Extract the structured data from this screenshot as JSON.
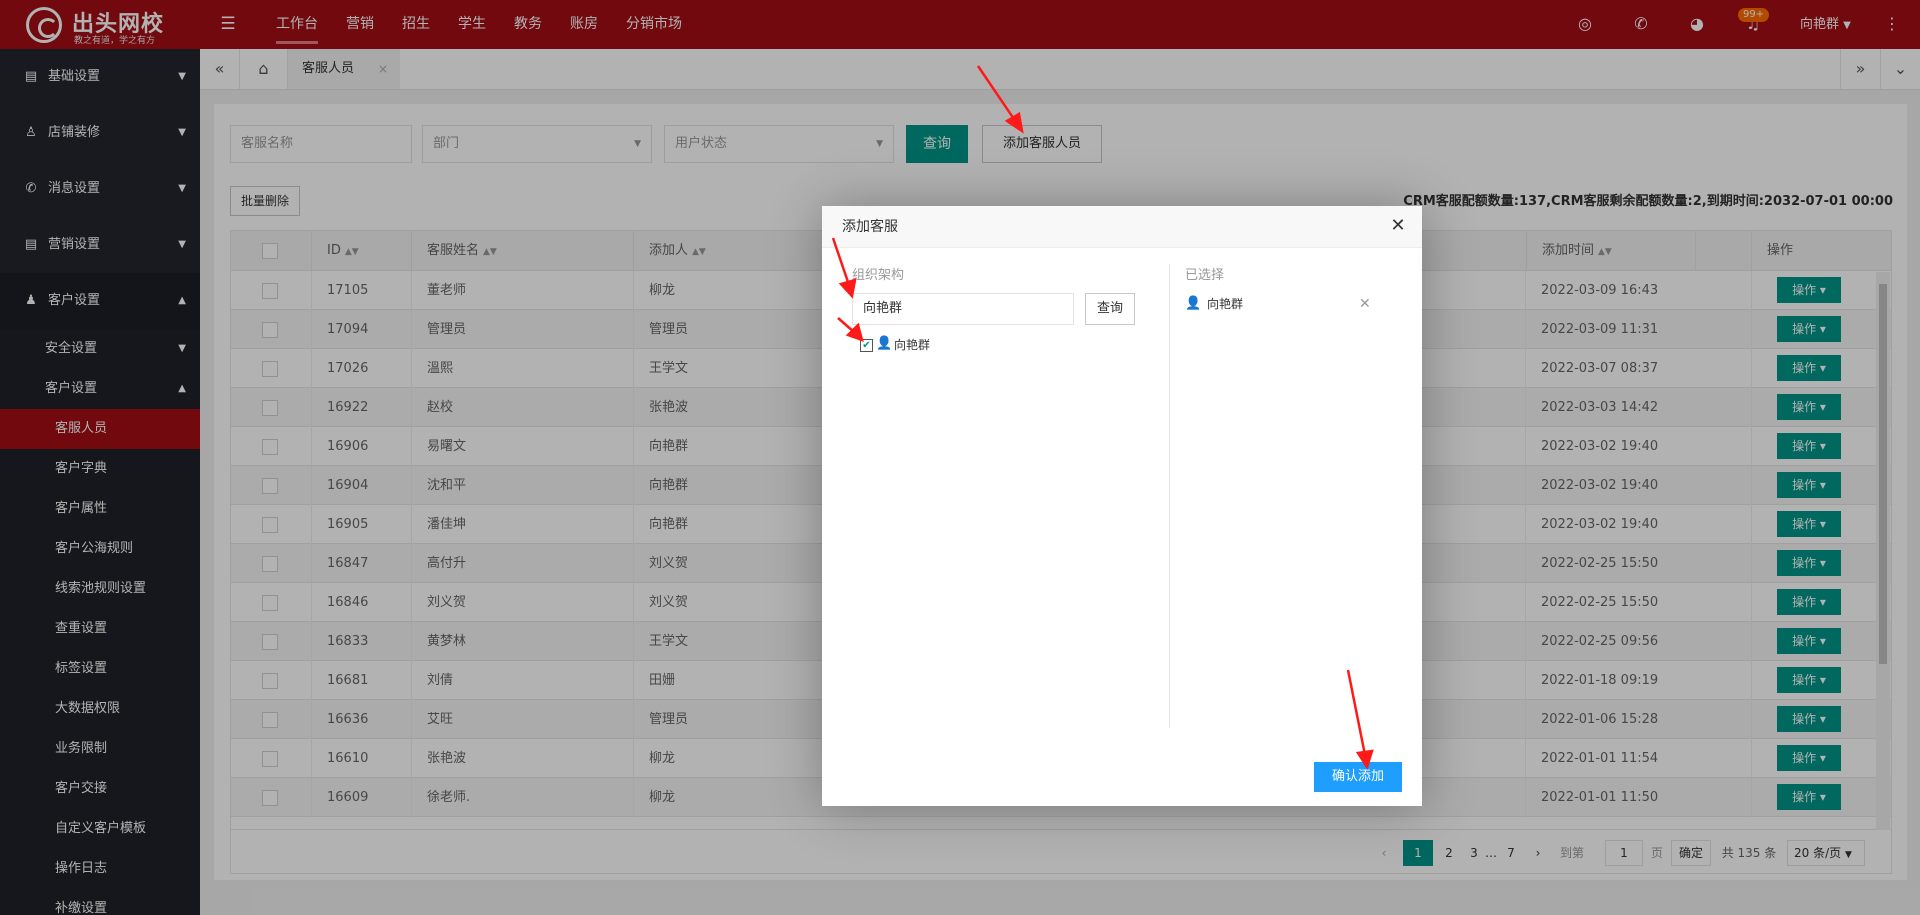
{
  "app": {
    "logo_title": "出头网校",
    "logo_slogan": "教之有道，学之有方"
  },
  "topnav": {
    "items": [
      "工作台",
      "营销",
      "招生",
      "学生",
      "教务",
      "账房",
      "分销市场"
    ],
    "active_index": 0,
    "notif_badge": "99+",
    "user_name": "向艳群"
  },
  "sidebar": {
    "groups": [
      {
        "label": "基础设置",
        "icon": "settings-doc-icon"
      },
      {
        "label": "店铺装修",
        "icon": "user-pen-icon"
      },
      {
        "label": "消息设置",
        "icon": "phone-icon"
      },
      {
        "label": "营销设置",
        "icon": "list-icon"
      },
      {
        "label": "客户设置",
        "icon": "customer-icon"
      }
    ],
    "subgroups": [
      "安全设置",
      "客户设置"
    ],
    "leaves": [
      "客服人员",
      "客户字典",
      "客户属性",
      "客户公海规则",
      "线索池规则设置",
      "查重设置",
      "标签设置",
      "大数据权限",
      "业务限制",
      "客户交接",
      "自定义客户模板",
      "操作日志",
      "补缴设置"
    ]
  },
  "tabbar": {
    "current_tab": "客服人员",
    "close": "×"
  },
  "filters": {
    "name_placeholder": "客服名称",
    "dept_placeholder": "部门",
    "status_placeholder": "用户状态",
    "query_label": "查询",
    "add_label": "添加客服人员",
    "batch_delete_label": "批量删除"
  },
  "crm_info": "CRM客服配额数量:137,CRM客服剩余配额数量:2,到期时间:2032-07-01 00:00",
  "table": {
    "headers": {
      "id": "ID",
      "name": "客服姓名",
      "adder": "添加人",
      "time": "添加时间",
      "op": "操作"
    },
    "op_label": "操作 ▾",
    "rows": [
      {
        "id": "17105",
        "name": "董老师",
        "adder": "柳龙",
        "time": "2022-03-09 16:43"
      },
      {
        "id": "17094",
        "name": "管理员",
        "adder": "管理员",
        "time": "2022-03-09 11:31"
      },
      {
        "id": "17026",
        "name": "溫熙",
        "adder": "王学文",
        "time": "2022-03-07 08:37"
      },
      {
        "id": "16922",
        "name": "赵校",
        "adder": "张艳波",
        "time": "2022-03-03 14:42"
      },
      {
        "id": "16906",
        "name": "易曙文",
        "adder": "向艳群",
        "time": "2022-03-02 19:40"
      },
      {
        "id": "16904",
        "name": "沈和平",
        "adder": "向艳群",
        "time": "2022-03-02 19:40"
      },
      {
        "id": "16905",
        "name": "潘佳坤",
        "adder": "向艳群",
        "time": "2022-03-02 19:40"
      },
      {
        "id": "16847",
        "name": "高付升",
        "adder": "刘义贺",
        "time": "2022-02-25 15:50"
      },
      {
        "id": "16846",
        "name": "刘义贺",
        "adder": "刘义贺",
        "time": "2022-02-25 15:50"
      },
      {
        "id": "16833",
        "name": "黄梦林",
        "adder": "王学文",
        "time": "2022-02-25 09:56"
      },
      {
        "id": "16681",
        "name": "刘倩",
        "adder": "田姗",
        "time": "2022-01-18 09:19"
      },
      {
        "id": "16636",
        "name": "艾旺",
        "adder": "管理员",
        "time": "2022-01-06 15:28"
      },
      {
        "id": "16610",
        "name": "张艳波",
        "adder": "柳龙",
        "time": "2022-01-01 11:54"
      },
      {
        "id": "16609",
        "name": "徐老师.",
        "adder": "柳龙",
        "time": "2022-01-01 11:50"
      }
    ]
  },
  "pager": {
    "prev": "‹",
    "pages": [
      "1",
      "2",
      "3",
      "…",
      "7"
    ],
    "current": "1",
    "next": "›",
    "goto_label": "到第",
    "goto_value": "1",
    "page_unit": "页",
    "confirm": "确定",
    "total": "共 135 条",
    "page_size": "20 条/页"
  },
  "dialog": {
    "title": "添加客服",
    "org_label": "组织架构",
    "search_value": "向艳群",
    "query_label": "查询",
    "tree_node": "向艳群",
    "selected_label": "已选择",
    "selected_item": "向艳群",
    "confirm_label": "确认添加"
  },
  "colors": {
    "brand_red": "#a20d15",
    "primary_teal": "#009688",
    "confirm_blue": "#1e9fff",
    "arrow_red": "#ff1a1a"
  }
}
